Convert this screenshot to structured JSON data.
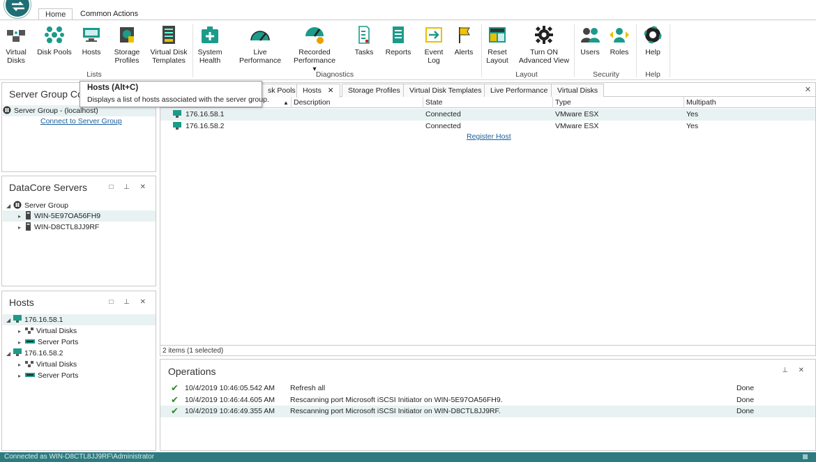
{
  "ribbon_tabs": [
    "Home",
    "Common Actions"
  ],
  "ribbon": {
    "buttons": [
      {
        "label1": "Virtual",
        "label2": "Disks",
        "icon": "virtual-disks-icon"
      },
      {
        "label1": "Disk Pools",
        "label2": "",
        "icon": "disk-pools-icon"
      },
      {
        "label1": "Hosts",
        "label2": "",
        "icon": "hosts-icon"
      },
      {
        "label1": "Storage",
        "label2": "Profiles",
        "icon": "storage-profiles-icon"
      },
      {
        "label1": "Virtual Disk",
        "label2": "Templates",
        "icon": "virtual-disk-templates-icon"
      },
      {
        "label1": "System",
        "label2": "Health",
        "icon": "system-health-icon"
      },
      {
        "label1": "Live Performance",
        "label2": "",
        "icon": "gauge-icon"
      },
      {
        "label1": "Recorded",
        "label2": "Performance ▾",
        "icon": "recorded-performance-icon"
      },
      {
        "label1": "Tasks",
        "label2": "",
        "icon": "tasks-icon"
      },
      {
        "label1": "Reports",
        "label2": "",
        "icon": "reports-icon"
      },
      {
        "label1": "Event",
        "label2": "Log",
        "icon": "event-log-icon"
      },
      {
        "label1": "Alerts",
        "label2": "",
        "icon": "alerts-flag-icon"
      },
      {
        "label1": "Reset",
        "label2": "Layout",
        "icon": "reset-layout-icon"
      },
      {
        "label1": "Turn ON",
        "label2": "Advanced View",
        "icon": "gear-icon"
      },
      {
        "label1": "Users",
        "label2": "",
        "icon": "users-icon"
      },
      {
        "label1": "Roles",
        "label2": "",
        "icon": "roles-icon"
      },
      {
        "label1": "Help",
        "label2": "",
        "icon": "help-lifebuoy-icon"
      }
    ],
    "groups": [
      "Lists",
      "Diagnostics",
      "Layout",
      "Security",
      "Help"
    ]
  },
  "tooltip": {
    "title": "Hosts (Alt+C)",
    "description": "Displays a list of hosts associated with the server group."
  },
  "server_group_panel": {
    "title": "Server Group Cor",
    "item": "Server Group - (localhost)",
    "link": "Connect to Server Group"
  },
  "datacore_panel": {
    "title": "DataCore Servers",
    "root": "Server Group",
    "servers": [
      "WIN-5E97OA56FH9",
      "WIN-D8CTL8JJ9RF"
    ]
  },
  "hosts_panel": {
    "title": "Hosts",
    "hosts": [
      {
        "name": "176.16.58.1",
        "children": [
          "Virtual Disks",
          "Server Ports"
        ]
      },
      {
        "name": "176.16.58.2",
        "children": [
          "Virtual Disks",
          "Server Ports"
        ]
      }
    ]
  },
  "document_tabs": [
    "sk Pools",
    "Hosts",
    "Storage Profiles",
    "Virtual Disk Templates",
    "Live Performance",
    "Virtual Disks"
  ],
  "grid": {
    "columns": [
      "Description",
      "State",
      "Type",
      "Multipath"
    ],
    "rows": [
      {
        "name": "176.16.58.1",
        "description": "",
        "state": "Connected",
        "type": "VMware ESX",
        "multipath": "Yes"
      },
      {
        "name": "176.16.58.2",
        "description": "",
        "state": "Connected",
        "type": "VMware ESX",
        "multipath": "Yes"
      }
    ],
    "register_link": "Register Host",
    "status": "2 items (1 selected)"
  },
  "operations": {
    "title": "Operations",
    "rows": [
      {
        "time": "10/4/2019 10:46:05.542 AM",
        "description": "Refresh all",
        "status": "Done"
      },
      {
        "time": "10/4/2019 10:46:44.605 AM",
        "description": "Rescanning port Microsoft iSCSI Initiator on WIN-5E97OA56FH9.",
        "status": "Done"
      },
      {
        "time": "10/4/2019 10:46:49.355 AM",
        "description": "Rescanning port Microsoft iSCSI Initiator on WIN-D8CTL8JJ9RF.",
        "status": "Done"
      }
    ]
  },
  "statusbar": {
    "text": "Connected as WIN-D8CTL8JJ9RF\\Administrator"
  },
  "colors": {
    "accent": "#2d7b80",
    "selection": "#e8f2f3",
    "check": "#2a8a2a",
    "link": "#1a5d9a"
  }
}
